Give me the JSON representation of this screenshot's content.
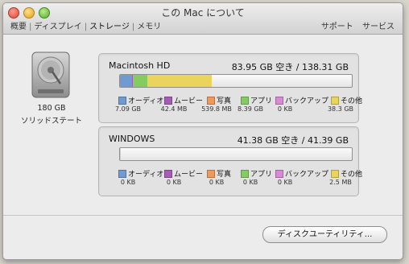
{
  "window": {
    "title": "この Mac について"
  },
  "tabs": [
    "概要",
    "ディスプレイ",
    "ストレージ",
    "メモリ"
  ],
  "top_links": {
    "support": "サポート",
    "service": "サービス"
  },
  "drive": {
    "size": "180 GB",
    "type": "ソリッドステート"
  },
  "legend_labels": [
    "オーディオ",
    "ムービー",
    "写真",
    "アプリ",
    "バックアップ",
    "その他"
  ],
  "colors": {
    "audio": "#6f9bd2",
    "movies": "#a45cb4",
    "photos": "#ef9a5a",
    "apps": "#84cc61",
    "backups": "#d98ad6",
    "other": "#ead45c",
    "free": "#f3f3f3"
  },
  "volumes": [
    {
      "name": "Macintosh HD",
      "stats": "83.95 GB 空き / 138.31 GB",
      "values": [
        "7.09 GB",
        "42.4 MB",
        "539.8 MB",
        "8.39 GB",
        "0 KB",
        "38.3 GB"
      ],
      "usage_fraction": {
        "audio": 0.051,
        "movies": 0.0003,
        "photos": 0.004,
        "apps": 0.061,
        "backups": 0,
        "other": 0.277
      }
    },
    {
      "name": "WINDOWS",
      "stats": "41.38 GB 空き / 41.39 GB",
      "values": [
        "0 KB",
        "0 KB",
        "0 KB",
        "0 KB",
        "0 KB",
        "2.5 MB"
      ],
      "usage_fraction": {
        "audio": 0,
        "movies": 0,
        "photos": 0,
        "apps": 0,
        "backups": 0,
        "other": 0.0001
      }
    }
  ],
  "disk_utility_button": "ディスクユーティリティ..."
}
